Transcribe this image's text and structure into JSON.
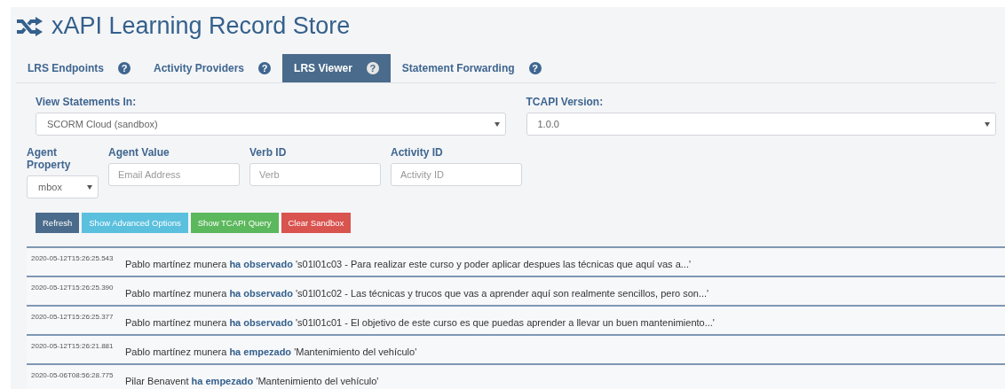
{
  "header": {
    "title": "xAPI Learning Record Store"
  },
  "tabs": [
    {
      "label": "LRS Endpoints",
      "help": "?",
      "selected": false
    },
    {
      "label": "Activity Providers",
      "help": "?",
      "selected": false
    },
    {
      "label": "LRS Viewer",
      "help": "?",
      "selected": true
    },
    {
      "label": "Statement Forwarding",
      "help": "?",
      "selected": false
    }
  ],
  "view_statements_in": {
    "label": "View Statements In:",
    "value": "SCORM Cloud (sandbox)"
  },
  "tcapi_version": {
    "label": "TCAPI Version:",
    "value": "1.0.0"
  },
  "filters": [
    {
      "kind": "select",
      "label": "Agent Property",
      "value": "mbox"
    },
    {
      "kind": "input",
      "label": "Agent Value",
      "placeholder": "Email Address"
    },
    {
      "kind": "input",
      "label": "Verb ID",
      "placeholder": "Verb"
    },
    {
      "kind": "input",
      "label": "Activity ID",
      "placeholder": "Activity ID"
    }
  ],
  "buttons": [
    {
      "label": "Refresh",
      "kind": "primary"
    },
    {
      "label": "Show Advanced Options",
      "kind": "info"
    },
    {
      "label": "Show TCAPI Query",
      "kind": "success"
    },
    {
      "label": "Clear Sandbox",
      "kind": "danger"
    }
  ],
  "statements": [
    {
      "timestamp": "2020-05-12T15:26:25.543",
      "text": "Pablo martínez munera **ha observado** 's01l01c03 - Para realizar este curso y poder aplicar despues las técnicas que aquí vas a...'"
    },
    {
      "timestamp": "2020-05-12T15:26:25.390",
      "text": "Pablo martínez munera **ha observado** 's01l01c02 - Las técnicas y trucos que vas a aprender aquí son realmente sencillos, pero son...'"
    },
    {
      "timestamp": "2020-05-12T15:26:25.377",
      "text": "Pablo martínez munera **ha observado** 's01l01c01 - El objetivo de este curso es que puedas aprender a llevar un buen mantenimiento...'"
    },
    {
      "timestamp": "2020-05-12T15:26:21.881",
      "text": "Pablo martínez munera **ha empezado** 'Mantenimiento del vehículo'"
    },
    {
      "timestamp": "2020-05-06T08:56:28.775",
      "text": "Pilar Benavent **ha empezado** 'Mantenimiento del vehículo'"
    }
  ]
}
